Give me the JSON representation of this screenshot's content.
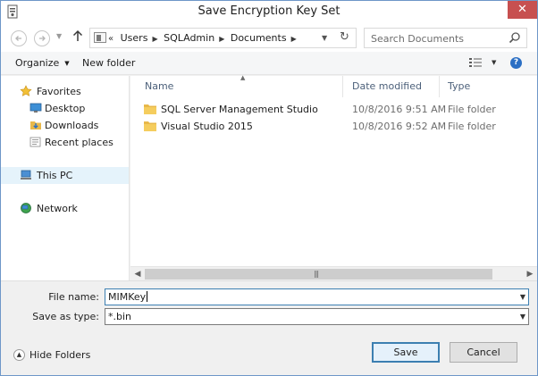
{
  "window": {
    "title": "Save Encryption Key Set",
    "close_glyph": "✕"
  },
  "nav": {
    "back_icon": "back-arrow-icon",
    "forward_icon": "forward-arrow-icon",
    "up_glyph": "🡑",
    "address": {
      "overflow": "«",
      "breadcrumbs": [
        "Users",
        "SQLAdmin",
        "Documents"
      ]
    },
    "search_placeholder": "Search Documents"
  },
  "toolbar": {
    "organize_label": "Organize",
    "new_folder_label": "New folder",
    "help_glyph": "?"
  },
  "sidebar": {
    "items": [
      {
        "label": "Favorites",
        "icon": "star-icon"
      },
      {
        "label": "Desktop",
        "icon": "desktop-icon"
      },
      {
        "label": "Downloads",
        "icon": "downloads-icon"
      },
      {
        "label": "Recent places",
        "icon": "recent-places-icon"
      },
      {
        "label": "This PC",
        "icon": "computer-icon",
        "selected": true
      },
      {
        "label": "Network",
        "icon": "network-icon"
      }
    ]
  },
  "filelist": {
    "columns": [
      "Name",
      "Date modified",
      "Type"
    ],
    "rows": [
      {
        "name": "SQL Server Management Studio",
        "date": "10/8/2016 9:51 AM",
        "type": "File folder"
      },
      {
        "name": "Visual Studio 2015",
        "date": "10/8/2016 9:52 AM",
        "type": "File folder"
      }
    ]
  },
  "form": {
    "file_name_label": "File name:",
    "file_name_value": "MIMKey",
    "save_as_type_label": "Save as type:",
    "save_as_type_value": "*.bin"
  },
  "footer": {
    "hide_folders_label": "Hide Folders",
    "save_label": "Save",
    "cancel_label": "Cancel"
  },
  "colors": {
    "accent": "#3c7fb1",
    "close": "#c75050",
    "selected": "#e5f3fb",
    "folder": "#e8b84a"
  }
}
